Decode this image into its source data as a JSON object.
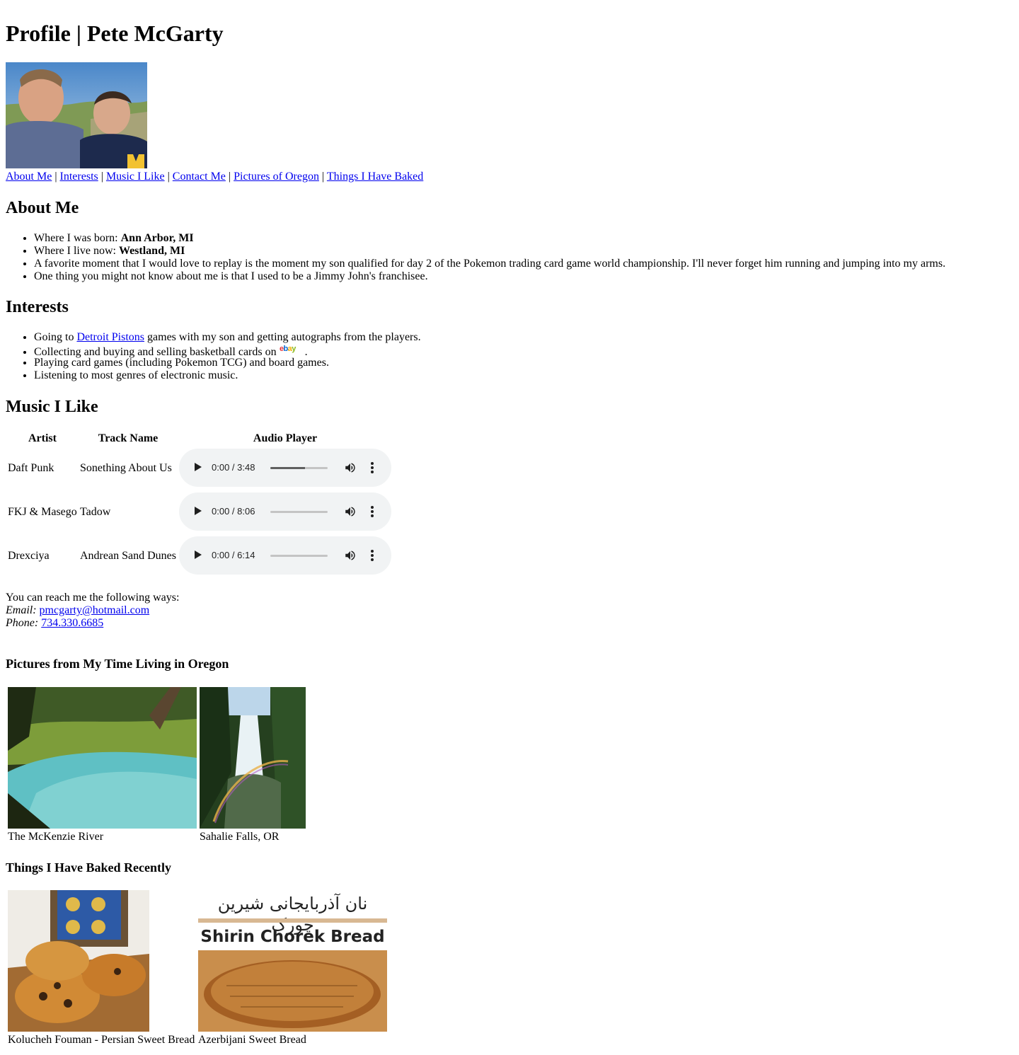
{
  "page_title": "Profile | Pete McGarty",
  "nav": {
    "items": [
      "About Me",
      "Interests",
      "Music I Like",
      "Contact Me",
      "Pictures of Oregon",
      "Things I Have Baked"
    ],
    "separator": "|"
  },
  "about": {
    "heading": "About Me",
    "born_label": "Where I was born:",
    "born_value": "Ann Arbor, MI",
    "live_label": "Where I live now:",
    "live_value": "Westland, MI",
    "moment": "A favorite moment that I would love to replay is the moment my son qualified for day 2 of the Pokemon trading card game world championship. I'll never forget him running and jumping into my arms.",
    "fact": "One thing you might not know about me is that I used to be a Jimmy John's franchisee."
  },
  "interests": {
    "heading": "Interests",
    "item1_pre": "Going to",
    "item1_link": "Detroit Pistons",
    "item1_post": "games with my son and getting autographs from the players.",
    "item2_pre": "Collecting and buying and selling basketball cards on",
    "item2_logo": "ebay",
    "item2_post": ".",
    "item3": "Playing card games (including Pokemon TCG) and board games.",
    "item4": "Listening to most genres of electronic music."
  },
  "music": {
    "heading": "Music I Like",
    "columns": [
      "Artist",
      "Track Name",
      "Audio Player"
    ],
    "rows": [
      {
        "artist": "Daft Punk",
        "track": "Sonething About Us",
        "time": "0:00 / 3:48",
        "progress": 0.6
      },
      {
        "artist": "FKJ & Masego",
        "track": "Tadow",
        "time": "0:00 / 8:06",
        "progress": 0
      },
      {
        "artist": "Drexciya",
        "track": "Andrean Sand Dunes",
        "time": "0:00 / 6:14",
        "progress": 0
      }
    ],
    "icons": [
      "play-icon",
      "volume-icon",
      "more-options-icon"
    ]
  },
  "contact": {
    "intro": "You can reach me the following ways:",
    "email_label": "Email:",
    "email": "pmcgarty@hotmail.com",
    "phone_label": "Phone:",
    "phone": "734.330.6685"
  },
  "oregon": {
    "heading": "Pictures from My Time Living in Oregon",
    "captions": [
      "The McKenzie River",
      "Sahalie Falls, OR"
    ]
  },
  "baked": {
    "heading": "Things I Have Baked Recently",
    "captions": [
      "Kolucheh Fouman - Persian Sweet Bread",
      "Azerbijani Sweet Bread"
    ],
    "image_text_arabic": "نان آذربایجانی شیرین چورک",
    "image_text_title": "Shirin Chorek Bread"
  },
  "colors": {
    "link": "#0000ee",
    "player_bg": "#f1f3f4"
  }
}
